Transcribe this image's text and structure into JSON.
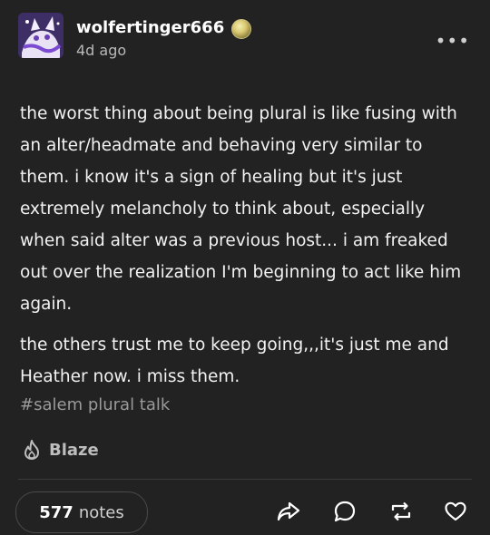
{
  "post": {
    "username": "wolfertinger666",
    "timestamp": "4d ago",
    "paragraphs": [
      "the worst thing about being plural is like fusing with an alter/headmate and behaving very similar to them. i know it's a sign of healing but it's just extremely melancholy to think about, especially when said alter was a previous host... i am freaked out over the realization I'm beginning to act like him again.",
      "the others trust me to keep going,,,it's just me and Heather now. i miss them."
    ],
    "tag": "#salem plural talk",
    "blaze_label": "Blaze"
  },
  "footer": {
    "notes_count": "577",
    "notes_label": "notes"
  },
  "icons": {
    "more": "more-horizontal-icon",
    "blaze": "flame-icon",
    "share": "share-icon",
    "reply": "reply-icon",
    "reblog": "reblog-icon",
    "like": "heart-icon"
  },
  "colors": {
    "background": "#222222",
    "text": "#f2f2f2",
    "muted": "#9a9a9a"
  }
}
